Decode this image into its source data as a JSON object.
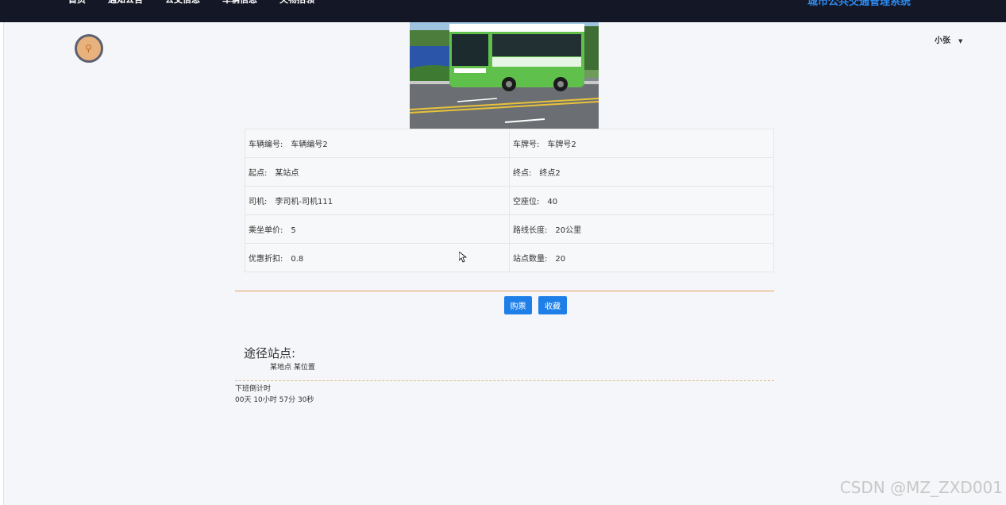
{
  "nav": {
    "items": [
      "首页",
      "通知公告",
      "公交信息",
      "车辆信息",
      "失物招领"
    ],
    "brand": "城市公共交通管理系统"
  },
  "user": {
    "name": "小张"
  },
  "bus": {
    "fields": [
      {
        "label": "车辆编号:",
        "value": "车辆编号2"
      },
      {
        "label": "车牌号:",
        "value": "车牌号2"
      },
      {
        "label": "起点:",
        "value": "某站点"
      },
      {
        "label": "终点:",
        "value": "终点2"
      },
      {
        "label": "司机:",
        "value": "李司机-司机111"
      },
      {
        "label": "空座位:",
        "value": "40"
      },
      {
        "label": "乘坐单价:",
        "value": "5"
      },
      {
        "label": "路线长度:",
        "value": "20公里"
      },
      {
        "label": "优惠折扣:",
        "value": "0.8"
      },
      {
        "label": "站点数量:",
        "value": "20"
      }
    ]
  },
  "actions": {
    "buy_label": "购票",
    "favorite_label": "收藏"
  },
  "route": {
    "title": "途径站点:",
    "stops": "某地点 某位置"
  },
  "countdown": {
    "label": "下班倒计时",
    "value": "00天 10小时 57分 30秒"
  },
  "watermark": "CSDN @MZ_ZXD001",
  "colors": {
    "topbar": "#141726",
    "accent": "#1e7fe8",
    "divider": "#e6a15c",
    "bus_body": "#5fc04b"
  }
}
